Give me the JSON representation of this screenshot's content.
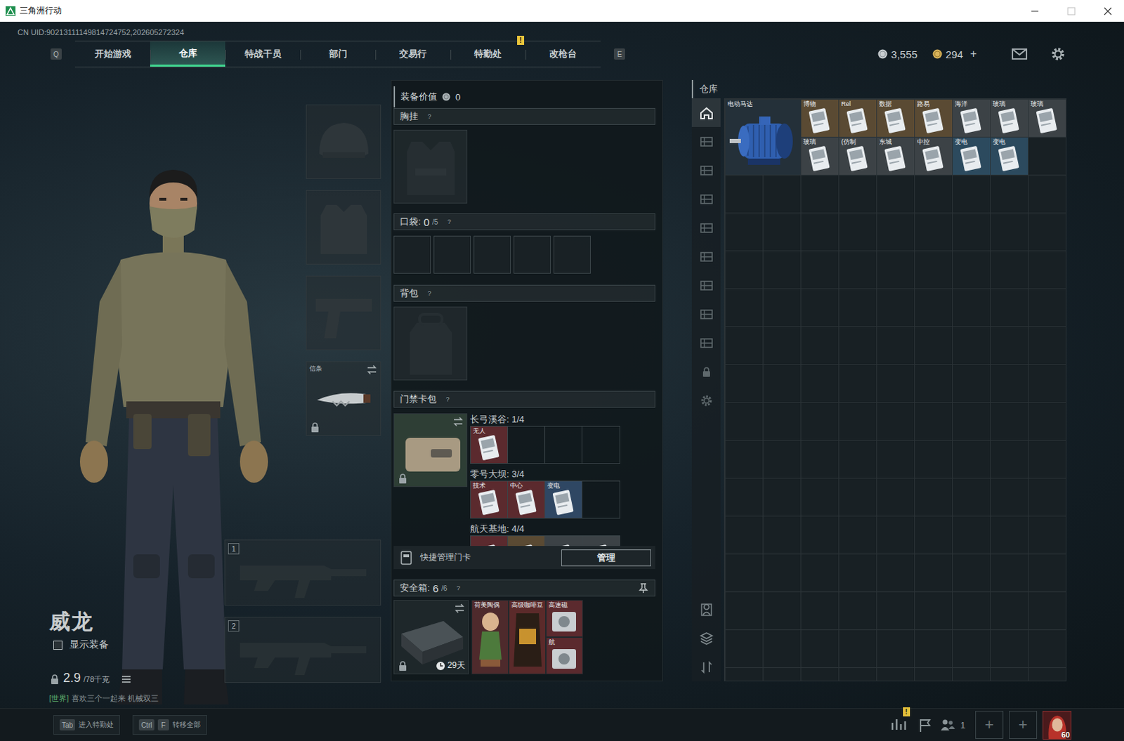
{
  "window": {
    "title": "三角洲行动"
  },
  "uid": "CN UID:90213111149814724752,202605272324",
  "nav": {
    "prev_key": "Q",
    "next_key": "E",
    "tabs": [
      {
        "label": "开始游戏",
        "selected": false
      },
      {
        "label": "仓库",
        "selected": true
      },
      {
        "label": "特战干员",
        "selected": false
      },
      {
        "label": "部门",
        "selected": false
      },
      {
        "label": "交易行",
        "selected": false
      },
      {
        "label": "特勤处",
        "selected": false,
        "badge": "!"
      },
      {
        "label": "改枪台",
        "selected": false
      }
    ]
  },
  "currencies": [
    {
      "kind": "silver",
      "value": "3,555"
    },
    {
      "kind": "gold",
      "value": "294",
      "add": "+"
    }
  ],
  "operator": {
    "name": "威龙",
    "show_equipment": {
      "label": "显示装备",
      "checked": false
    },
    "weight": "2.9",
    "weight_max": "/78千克"
  },
  "chat": {
    "channel": "[世界]",
    "message": "喜欢三个一起来  机械双三"
  },
  "gear_slots": [
    {
      "kind": "helmet"
    },
    {
      "kind": "armor"
    },
    {
      "kind": "pistol"
    },
    {
      "kind": "melee",
      "label": "信条",
      "locked": true
    }
  ],
  "weapon_slots": [
    {
      "number": "1"
    },
    {
      "number": "2"
    }
  ],
  "loadout": {
    "value_label": "装备价值",
    "value": "0",
    "chest": {
      "label": "胸挂",
      "help": "?"
    },
    "pockets": {
      "label": "口袋:",
      "count": "0",
      "capacity": "/5",
      "help": "?",
      "slots": [
        {
          "empty": true
        },
        {
          "empty": true
        },
        {
          "empty": true
        },
        {
          "empty": true
        },
        {
          "empty": true
        }
      ]
    },
    "backpack": {
      "label": "背包",
      "help": "?"
    },
    "keycards": {
      "label": "门禁卡包",
      "help": "?",
      "locked": true,
      "maps": [
        {
          "title": "长弓溪谷: 1/4",
          "slots": [
            {
              "empty": false,
              "label": "无人",
              "color": "#5b2a2e"
            },
            {
              "empty": true
            },
            {
              "empty": true
            },
            {
              "empty": true
            }
          ]
        },
        {
          "title": "零号大坝: 3/4",
          "slots": [
            {
              "empty": false,
              "label": "技术",
              "color": "#5b2a2e"
            },
            {
              "empty": false,
              "label": "中心",
              "color": "#5b2a2e"
            },
            {
              "empty": false,
              "label": "变电",
              "color": "#2f4763"
            },
            {
              "empty": true
            }
          ]
        },
        {
          "title": "航天基地: 4/4",
          "slots": [
            {
              "empty": false,
              "color": "#5b2a2e"
            },
            {
              "empty": false,
              "color": "#5a4a33"
            },
            {
              "empty": false,
              "color": "#3c4246"
            },
            {
              "empty": false,
              "color": "#3c4246"
            }
          ]
        }
      ]
    },
    "quick_manage": {
      "label": "快捷管理门卡",
      "button": "管理"
    },
    "safebox": {
      "label": "安全箱:",
      "count": "6",
      "capacity": "/6",
      "help": "?",
      "locked": true,
      "expires": "29天",
      "items": [
        {
          "kind": "tall",
          "label": "荷美陶偶",
          "color": "#4e2a2c"
        },
        {
          "kind": "tall",
          "label": "高级咖啡豆",
          "color": "#5b2a2a"
        },
        {
          "kind": "small",
          "label": "高速磁",
          "color": "#5b2a2e"
        },
        {
          "kind": "small",
          "label": "航",
          "color": "#5b2a2e"
        }
      ]
    }
  },
  "warehouse": {
    "label": "仓库",
    "sidebar": {
      "top": [
        {
          "kind": "home",
          "selected": true
        },
        {
          "kind": "shelf",
          "selected": false
        },
        {
          "kind": "shelf",
          "selected": false
        },
        {
          "kind": "shelf",
          "selected": false
        },
        {
          "kind": "shelf",
          "selected": false
        },
        {
          "kind": "shelf",
          "selected": false
        },
        {
          "kind": "shelf",
          "selected": false
        },
        {
          "kind": "shelf",
          "selected": false
        },
        {
          "kind": "shelf",
          "selected": false
        },
        {
          "kind": "lock",
          "selected": false
        },
        {
          "kind": "gear",
          "selected": false
        }
      ],
      "bottom": [
        {
          "kind": "person"
        },
        {
          "kind": "layers"
        },
        {
          "kind": "sort"
        }
      ]
    },
    "items": [
      {
        "kind": "motor",
        "label": "电动马达",
        "color": "#243039"
      },
      {
        "kind": "card",
        "label": "博物",
        "color": "#5a4a33"
      },
      {
        "kind": "card",
        "label": "Rel",
        "color": "#5a4a33"
      },
      {
        "kind": "card",
        "label": "数据",
        "color": "#5a4a33"
      },
      {
        "kind": "card",
        "label": "路易",
        "color": "#5a4a33"
      },
      {
        "kind": "card",
        "label": "海洋",
        "color": "#3c4246"
      },
      {
        "kind": "card",
        "label": "玻璃",
        "color": "#3c4246"
      },
      {
        "kind": "card",
        "label": "玻璃",
        "color": "#3c4246"
      },
      {
        "kind": "card",
        "label": "玻璃",
        "color": "#3c4246"
      },
      {
        "kind": "card",
        "label": "(仿制",
        "color": "#3c4246"
      },
      {
        "kind": "card",
        "label": "东城",
        "color": "#3c4246"
      },
      {
        "kind": "card",
        "label": "中控",
        "color": "#3c4246"
      },
      {
        "kind": "card",
        "label": "变电",
        "color": "#2c4a5e"
      },
      {
        "kind": "card",
        "label": "变电",
        "color": "#2c4a5e"
      }
    ]
  },
  "hints": [
    {
      "keys": [
        "Tab"
      ],
      "label": "进入特勤处"
    },
    {
      "keys": [
        "Ctrl",
        "F"
      ],
      "label": "转移全部"
    }
  ],
  "tray": {
    "alert": "!",
    "party_count": "1",
    "add_slots": [
      "+",
      "+"
    ],
    "level": "60"
  }
}
